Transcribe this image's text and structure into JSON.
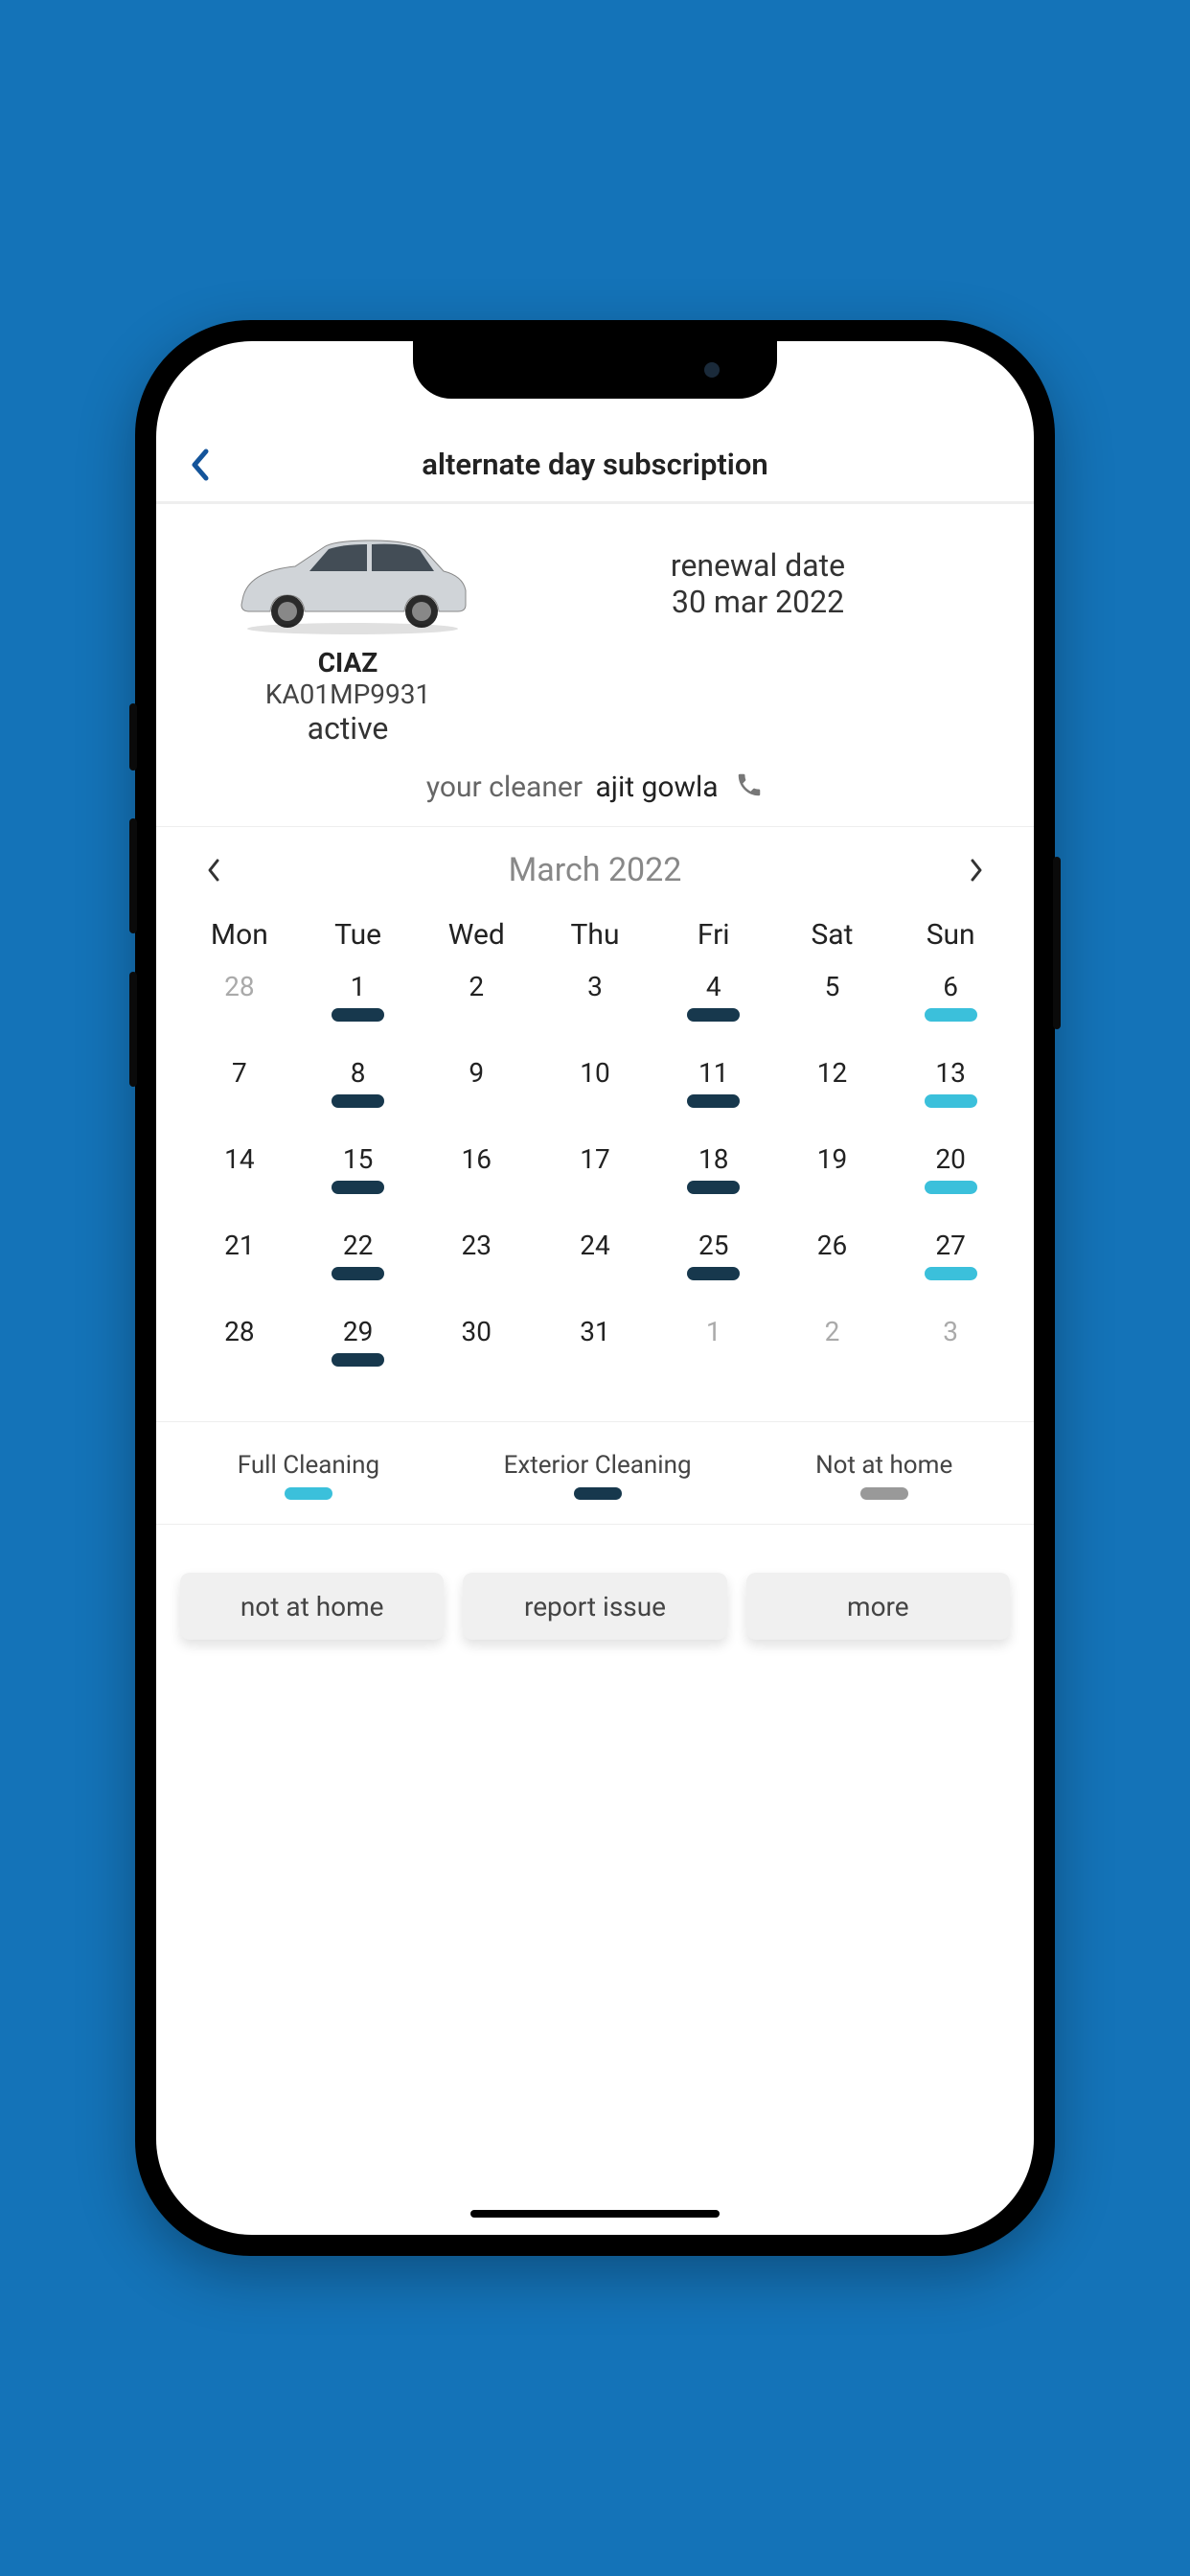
{
  "header": {
    "title": "alternate day subscription"
  },
  "vehicle": {
    "name": "CIAZ",
    "plate": "KA01MP9931",
    "status": "active"
  },
  "renewal": {
    "label": "renewal date",
    "date": "30 mar 2022"
  },
  "cleaner": {
    "label": "your cleaner",
    "name": "ajit gowla"
  },
  "calendar": {
    "month": "March 2022",
    "weekdays": [
      "Mon",
      "Tue",
      "Wed",
      "Thu",
      "Fri",
      "Sat",
      "Sun"
    ],
    "rows": [
      [
        {
          "d": "28",
          "faded": true,
          "m": null
        },
        {
          "d": "1",
          "m": "ext"
        },
        {
          "d": "2",
          "m": null
        },
        {
          "d": "3",
          "m": null
        },
        {
          "d": "4",
          "m": "ext"
        },
        {
          "d": "5",
          "m": null
        },
        {
          "d": "6",
          "m": "full"
        }
      ],
      [
        {
          "d": "7",
          "m": null
        },
        {
          "d": "8",
          "m": "ext"
        },
        {
          "d": "9",
          "m": null
        },
        {
          "d": "10",
          "m": null
        },
        {
          "d": "11",
          "m": "ext"
        },
        {
          "d": "12",
          "m": null
        },
        {
          "d": "13",
          "m": "full"
        }
      ],
      [
        {
          "d": "14",
          "m": null
        },
        {
          "d": "15",
          "m": "ext"
        },
        {
          "d": "16",
          "m": null
        },
        {
          "d": "17",
          "m": null
        },
        {
          "d": "18",
          "m": "ext"
        },
        {
          "d": "19",
          "m": null
        },
        {
          "d": "20",
          "m": "full"
        }
      ],
      [
        {
          "d": "21",
          "m": null
        },
        {
          "d": "22",
          "m": "ext"
        },
        {
          "d": "23",
          "m": null
        },
        {
          "d": "24",
          "m": null
        },
        {
          "d": "25",
          "m": "ext"
        },
        {
          "d": "26",
          "m": null
        },
        {
          "d": "27",
          "m": "full"
        }
      ],
      [
        {
          "d": "28",
          "m": null
        },
        {
          "d": "29",
          "m": "ext"
        },
        {
          "d": "30",
          "m": null
        },
        {
          "d": "31",
          "m": null
        },
        {
          "d": "1",
          "faded": true,
          "m": null
        },
        {
          "d": "2",
          "faded": true,
          "m": null
        },
        {
          "d": "3",
          "faded": true,
          "m": null
        }
      ]
    ]
  },
  "legend": [
    {
      "label": "Full Cleaning",
      "type": "full"
    },
    {
      "label": "Exterior Cleaning",
      "type": "ext"
    },
    {
      "label": "Not at home",
      "type": "nah"
    }
  ],
  "actions": {
    "not_at_home": "not at home",
    "report_issue": "report issue",
    "more": "more"
  }
}
